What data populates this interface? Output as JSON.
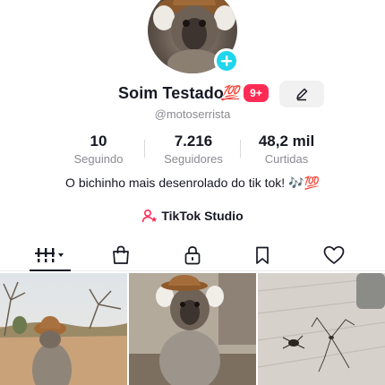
{
  "profile": {
    "display_name": "Soim Testado",
    "name_emoji": "💯",
    "notification_badge": "9+",
    "handle": "@motoserrista",
    "bio": "O bichinho mais desenrolado do tik tok! 🎶💯"
  },
  "stats": [
    {
      "value": "10",
      "label": "Seguindo"
    },
    {
      "value": "7.216",
      "label": "Seguidores"
    },
    {
      "value": "48,2 mil",
      "label": "Curtidas"
    }
  ],
  "studio": {
    "label": "TikTok Studio"
  },
  "tabs": [
    {
      "name": "videos-grid-icon",
      "active": true
    },
    {
      "name": "shop-bag-icon",
      "active": false
    },
    {
      "name": "lock-icon",
      "active": false
    },
    {
      "name": "bookmark-icon",
      "active": false
    },
    {
      "name": "heart-icon",
      "active": false
    }
  ],
  "colors": {
    "accent_cyan": "#20d5ec",
    "badge_red": "#fe2c55",
    "text_primary": "#161823",
    "text_secondary": "#8a8b91"
  }
}
